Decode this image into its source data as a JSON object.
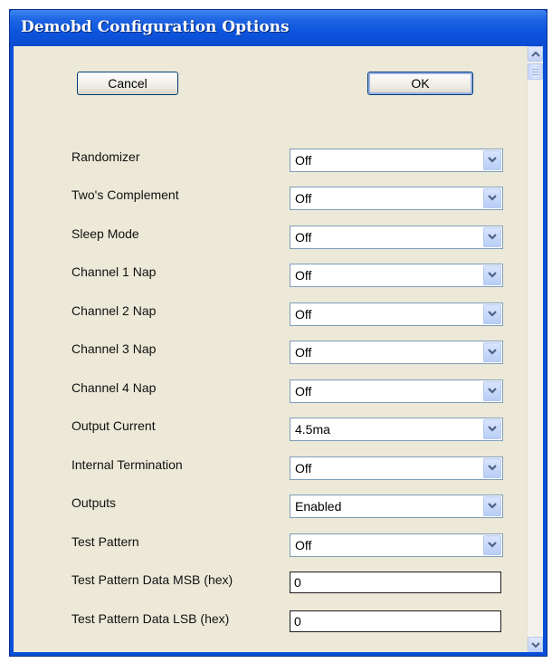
{
  "window": {
    "title": "Demobd Configuration Options"
  },
  "buttons": {
    "cancel_label": "Cancel",
    "ok_label": "OK"
  },
  "settings": [
    {
      "label": "Randomizer",
      "value": "Off"
    },
    {
      "label": "Two's Complement",
      "value": "Off"
    },
    {
      "label": "Sleep Mode",
      "value": "Off"
    },
    {
      "label": "Channel 1 Nap",
      "value": "Off"
    },
    {
      "label": "Channel 2 Nap",
      "value": "Off"
    },
    {
      "label": "Channel 3 Nap",
      "value": "Off"
    },
    {
      "label": "Channel 4 Nap",
      "value": "Off"
    },
    {
      "label": "Output Current",
      "value": "4.5ma"
    },
    {
      "label": "Internal Termination",
      "value": "Off"
    },
    {
      "label": "Outputs",
      "value": "Enabled"
    },
    {
      "label": "Test Pattern",
      "value": "Off"
    }
  ],
  "hex_fields": [
    {
      "label": "Test Pattern Data MSB (hex)",
      "value": "0"
    },
    {
      "label": "Test Pattern Data LSB (hex)",
      "value": "0"
    }
  ],
  "icons": {
    "dropdown": "chevron-down-icon",
    "scroll_up": "arrow-up-icon",
    "scroll_down": "arrow-down-icon"
  },
  "colors": {
    "titlebar": "#0a4fd8",
    "client_bg": "#ece9d8",
    "field_border": "#7f9db9"
  }
}
